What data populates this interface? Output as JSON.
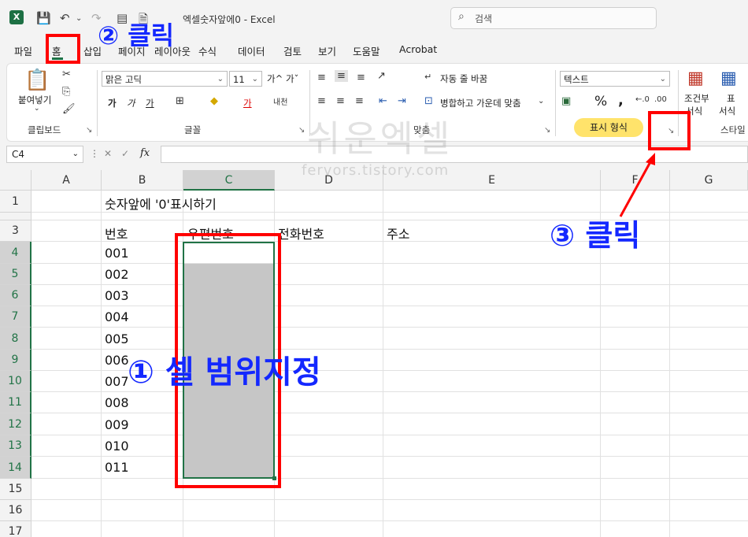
{
  "title_bar": {
    "doc_title": "엑셀숫자앞에0  -  Excel",
    "search_placeholder": "검색",
    "app_icon": "X"
  },
  "menu": {
    "tabs": [
      "파일",
      "홈",
      "삽입",
      "페이지",
      "레이아웃",
      "수식",
      "데이터",
      "검토",
      "보기",
      "도움말",
      "Acrobat"
    ]
  },
  "ribbon": {
    "clipboard": {
      "paste_label": "붙여넣기",
      "group_label": "클립보드"
    },
    "font": {
      "font_name": "맑은 고딕",
      "font_size": "11",
      "grow": "가^",
      "shrink": "가ˇ",
      "bold": "가",
      "italic": "가",
      "underline": "가",
      "color_char": "가",
      "group_label": "글꼴"
    },
    "alignment": {
      "wrap_text": "자동 줄 바꿈",
      "merge_center": "병합하고 가운데 맞춤",
      "group_label": "맞춤"
    },
    "number": {
      "format_value": "텍스트",
      "percent": "%",
      "comma": ",",
      "group_label": "표시 형식"
    },
    "styles": {
      "conditional": "조건부",
      "conditional2": "서식",
      "table": "표",
      "table2": "서식",
      "group_label": "스타일"
    }
  },
  "formula_bar": {
    "name_box": "C4",
    "fx": "fx",
    "cancel": "✕",
    "enter": "✓"
  },
  "sheet": {
    "columns": [
      "A",
      "B",
      "C",
      "D",
      "E",
      "F",
      "G"
    ],
    "rows": [
      "1",
      "3",
      "4",
      "5",
      "6",
      "7",
      "8",
      "9",
      "10",
      "11",
      "12",
      "13",
      "14",
      "15",
      "16",
      "17"
    ],
    "title_cell": "숫자앞에 '0'표시하기",
    "headers": [
      "번호",
      "우편번호",
      "전화번호",
      "주소"
    ],
    "numbers": [
      "001",
      "002",
      "003",
      "004",
      "005",
      "006",
      "007",
      "008",
      "009",
      "010",
      "011"
    ]
  },
  "annotations": {
    "step1": "① 셀 범위지정",
    "step2": "② 클릭",
    "step3": "③ 클릭",
    "color": "#1428ff",
    "box_color": "#ff0000"
  },
  "watermark": {
    "main": "쉬운엑셀",
    "sub": "fervors.tistory.com"
  },
  "colors": {
    "excel_green": "#217346",
    "selection_fill": "#c6c6c6",
    "numfmt_highlight": "#ffe36b"
  }
}
